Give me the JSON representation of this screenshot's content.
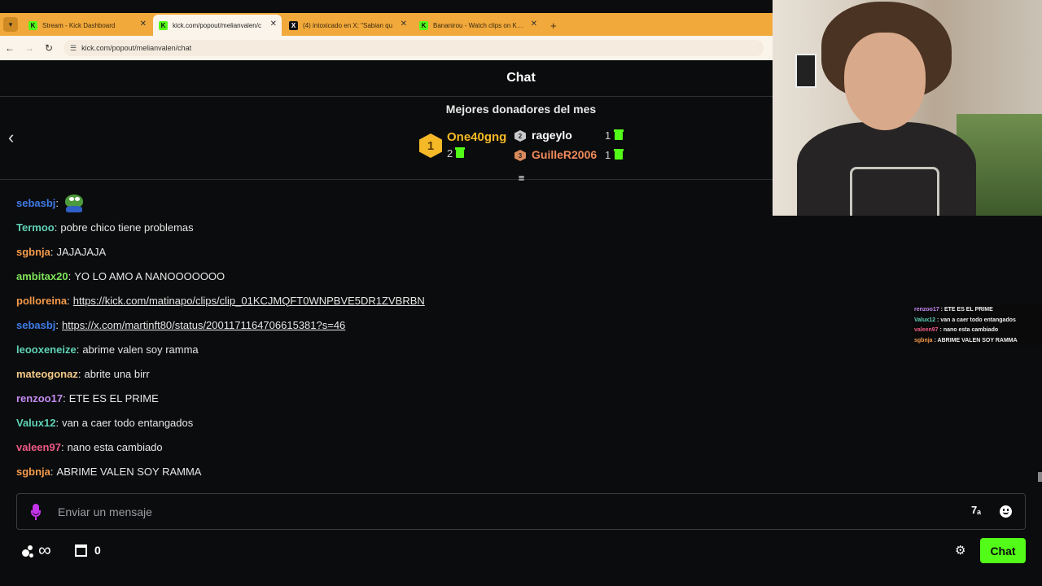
{
  "browser": {
    "tabs": [
      {
        "label": "Stream - Kick Dashboard",
        "icon": "kick-icon",
        "active": false
      },
      {
        "label": "kick.com/popout/melianvalen/c",
        "icon": "kick-icon",
        "active": true
      },
      {
        "label": "(4) intoxicado en X: \"Sabian qu",
        "icon": "x-icon",
        "active": false
      },
      {
        "label": "Bananirou - Watch clips on Kick",
        "icon": "kick-icon",
        "active": false
      }
    ],
    "url": "kick.com/popout/melianvalen/chat",
    "new_tab": "+",
    "close_glyph": "✕"
  },
  "chat": {
    "title": "Chat",
    "leaderboard": {
      "title": "Mejores donadores del mes",
      "first": {
        "rank": "1",
        "name": "One40gng",
        "count": "2"
      },
      "others": [
        {
          "rank": "2",
          "name": "rageylo",
          "count": "1",
          "color": "#ffffff",
          "medal_color": "#c9c9c9"
        },
        {
          "rank": "3",
          "name": "GuilleR2006",
          "count": "1",
          "color": "#f08a5d",
          "medal_color": "#d98a5b"
        }
      ]
    },
    "messages": [
      {
        "user": "sebasbj",
        "color": "#3f7be8",
        "text": "",
        "emote": "pepe-emote"
      },
      {
        "user": "Termoo",
        "color": "#5fd3b8",
        "text": "pobre chico tiene problemas"
      },
      {
        "user": "sgbnja",
        "color": "#f59a4a",
        "text": "JAJAJAJA"
      },
      {
        "user": "ambitax20",
        "color": "#7ee35a",
        "text": "YO LO AMO A NANOOOOOOO"
      },
      {
        "user": "polloreina",
        "color": "#f59a4a",
        "link": "https://kick.com/matinapo/clips/clip_01KCJMQFT0WNPBVE5DR1ZVBRBN"
      },
      {
        "user": "sebasbj",
        "color": "#3f7be8",
        "link": "https://x.com/martinft80/status/2001171164706615381?s=46"
      },
      {
        "user": "leooxeneize",
        "color": "#5fd3b8",
        "text": "abrime valen soy ramma"
      },
      {
        "user": "mateogonaz",
        "color": "#f2c98a",
        "text": "abrite una birr"
      },
      {
        "user": "renzoo17",
        "color": "#c48cf2",
        "text": "ETE ES EL PRIME"
      },
      {
        "user": "Valux12",
        "color": "#5fd3b8",
        "text": "van a caer todo entangados"
      },
      {
        "user": "valeen97",
        "color": "#ef5a86",
        "text": "nano esta cambiado"
      },
      {
        "user": "sgbnja",
        "color": "#f59a4a",
        "text": "ABRIME VALEN SOY RAMMA"
      }
    ],
    "input": {
      "placeholder": "Enviar un mensaje",
      "value": "",
      "translate_glyph": "7ₐ"
    },
    "footer": {
      "points": "∞",
      "store_count": "0",
      "chat_button": "Chat"
    }
  },
  "overlay": {
    "lines": [
      {
        "user": "renzoo17",
        "color": "#c48cf2",
        "text": "ETE ES EL PRIME"
      },
      {
        "user": "Valux12",
        "color": "#5fd3b8",
        "text": "van a caer todo entangados"
      },
      {
        "user": "valeen97",
        "color": "#ef5a86",
        "text": "nano esta cambiado"
      },
      {
        "user": "sgbnja",
        "color": "#f59a4a",
        "text": "ABRIME VALEN SOY RAMMA"
      }
    ]
  },
  "colors": {
    "accent": "#53fc18",
    "background": "#0b0c0d",
    "tabbar": "#f2a93b",
    "mic": "#c433e8"
  }
}
